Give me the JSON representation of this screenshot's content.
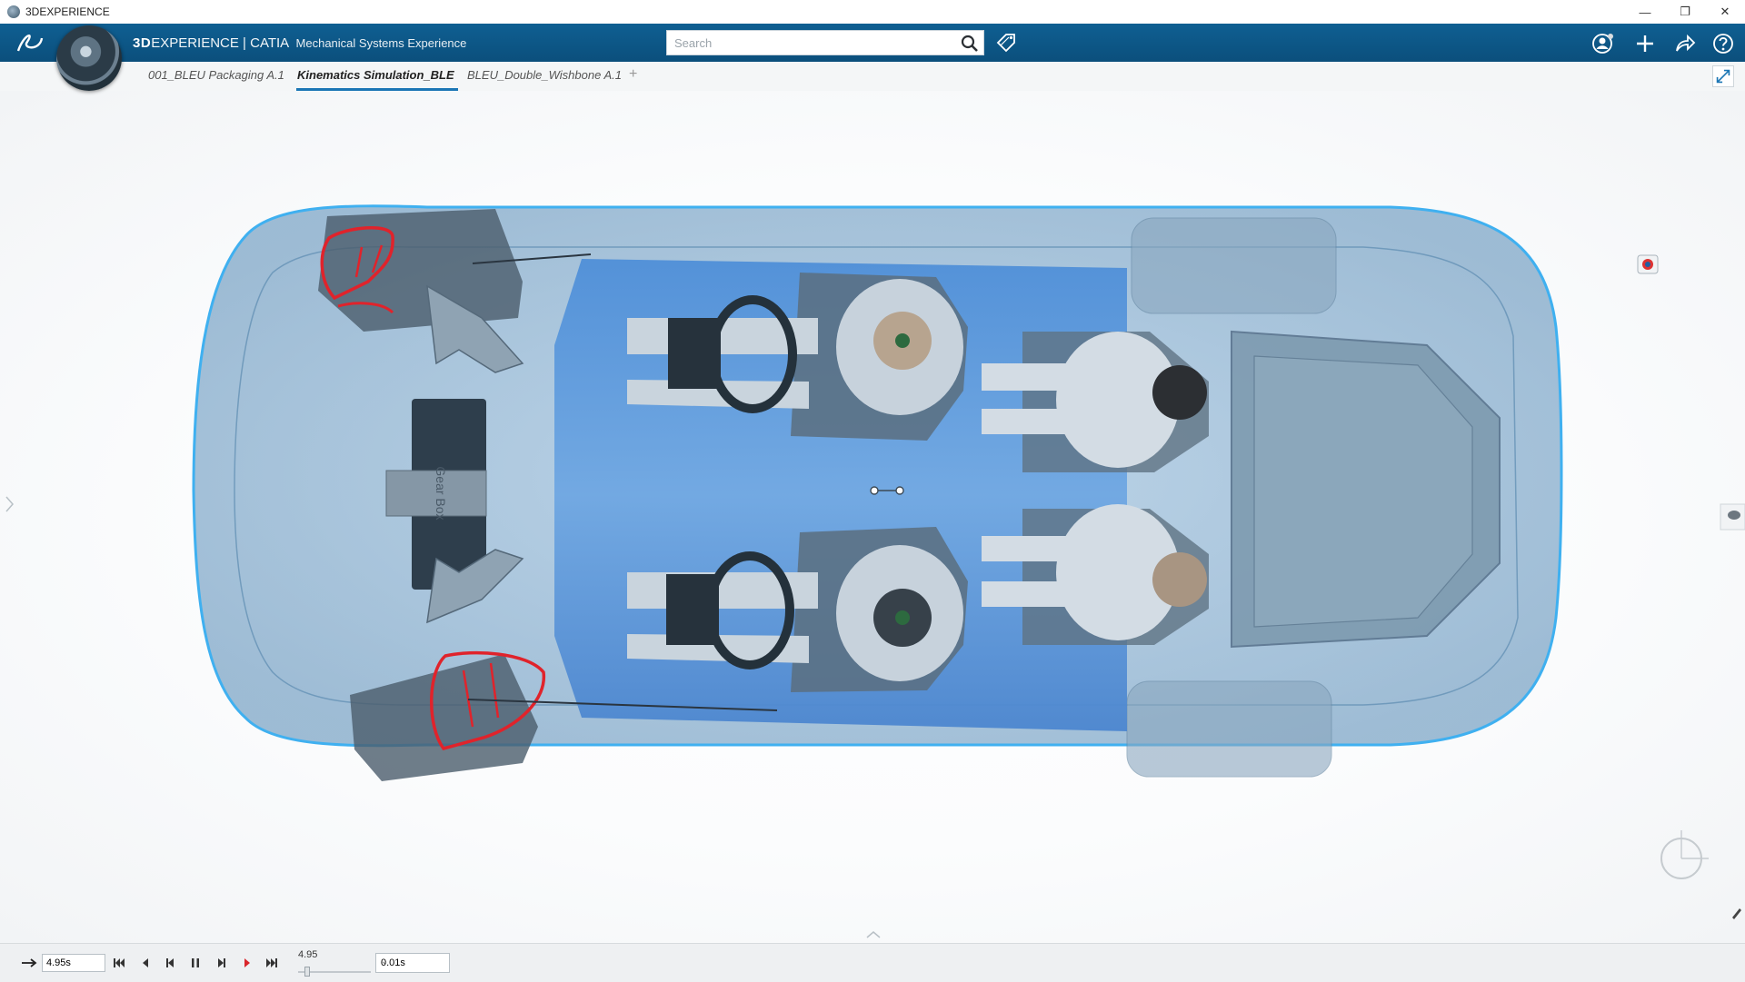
{
  "window": {
    "title": "3DEXPERIENCE"
  },
  "topbar": {
    "brand_bold": "3D",
    "brand_rest": "EXPERIENCE | CATIA",
    "app_name": "Mechanical Systems Experience",
    "search_placeholder": "Search"
  },
  "tabs": [
    {
      "label": "001_BLEU Packaging A.1"
    },
    {
      "label": "Kinematics Simulation_BLE"
    },
    {
      "label": "BLEU_Double_Wishbone A.1"
    }
  ],
  "viewport": {
    "engine_label": "Gear Box"
  },
  "timeline": {
    "time_value": "4.95s",
    "slider_value": "4.95",
    "step_value": "0.01s"
  },
  "colors": {
    "accent": "#0b4f7c",
    "tab_underline": "#1b76b5",
    "car_blue": "#3f8fd6",
    "highlight_red": "#e0232b"
  }
}
